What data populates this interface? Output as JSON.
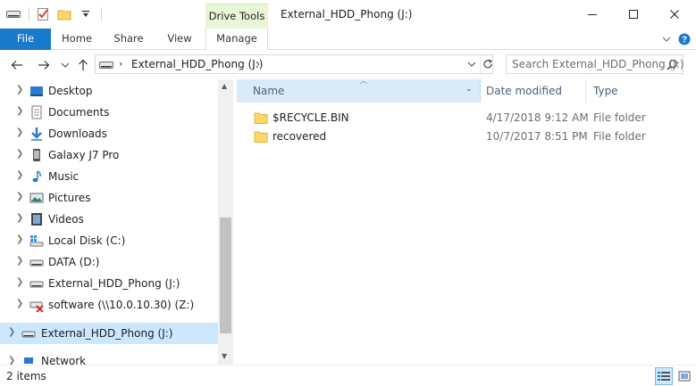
{
  "window": {
    "title": "External_HDD_Phong (J:)",
    "context_tab_group": "Drive Tools"
  },
  "ribbon": {
    "tabs": [
      {
        "label": "File"
      },
      {
        "label": "Home"
      },
      {
        "label": "Share"
      },
      {
        "label": "View"
      },
      {
        "label": "Manage"
      }
    ]
  },
  "address": {
    "crumbs": [
      "External_HDD_Phong (J:)"
    ]
  },
  "search": {
    "placeholder": "Search External_HDD_Phong (J:)"
  },
  "nav_pane": {
    "items": [
      {
        "label": "Desktop",
        "icon": "desktop-icon"
      },
      {
        "label": "Documents",
        "icon": "documents-icon"
      },
      {
        "label": "Downloads",
        "icon": "downloads-icon"
      },
      {
        "label": "Galaxy J7 Pro",
        "icon": "phone-icon"
      },
      {
        "label": "Music",
        "icon": "music-icon"
      },
      {
        "label": "Pictures",
        "icon": "pictures-icon"
      },
      {
        "label": "Videos",
        "icon": "videos-icon"
      },
      {
        "label": "Local Disk (C:)",
        "icon": "windows-drive-icon"
      },
      {
        "label": "DATA (D:)",
        "icon": "drive-icon"
      },
      {
        "label": "External_HDD_Phong (J:)",
        "icon": "drive-icon"
      },
      {
        "label": "software (\\\\10.0.10.30) (Z:)",
        "icon": "disconnected-network-drive-icon"
      },
      {
        "label": "External_HDD_Phong (J:)",
        "icon": "drive-icon",
        "selected": true
      },
      {
        "label": "Network",
        "icon": "network-icon"
      }
    ]
  },
  "file_list": {
    "columns": [
      "Name",
      "Date modified",
      "Type"
    ],
    "sorted_by": "Name",
    "rows": [
      {
        "name": "$RECYCLE.BIN",
        "date_modified": "4/17/2018 9:12 AM",
        "type": "File folder"
      },
      {
        "name": "recovered",
        "date_modified": "10/7/2017 8:51 PM",
        "type": "File folder"
      }
    ]
  },
  "status_bar": {
    "item_count": "2 items"
  },
  "colors": {
    "file_tab": "#1979ca",
    "context_tab": "#e7f6d6",
    "selection": "#cce8ff",
    "folder": "#ffd767"
  }
}
